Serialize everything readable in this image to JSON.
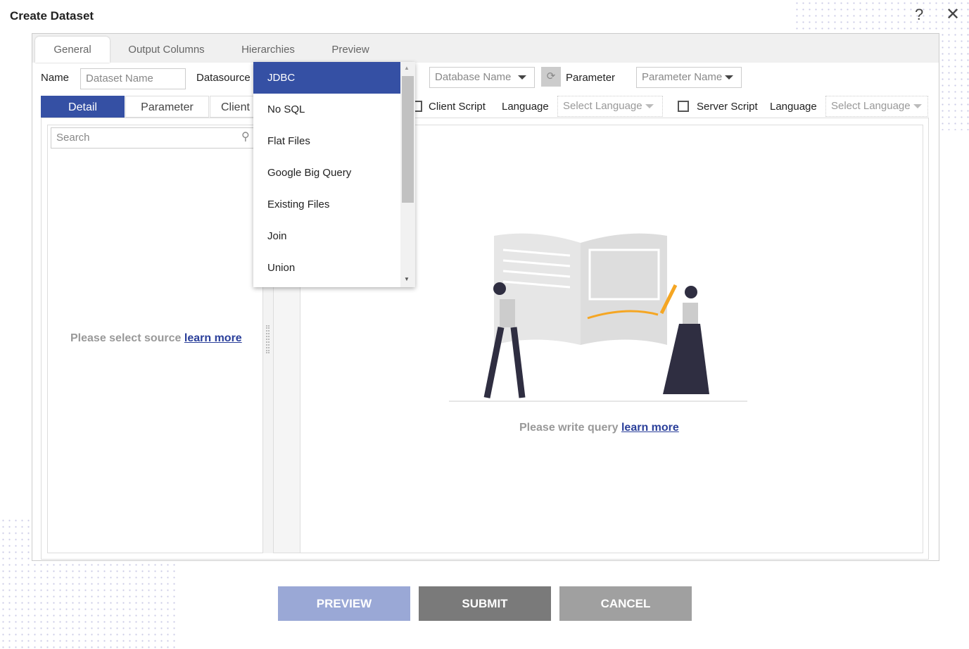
{
  "title": "Create Dataset",
  "tabs": [
    "General",
    "Output Columns",
    "Hierarchies",
    "Preview"
  ],
  "name_label": "Name",
  "name_placeholder": "Dataset Name",
  "datasource_label": "Datasource",
  "datasource_options": [
    "JDBC",
    "No SQL",
    "Flat Files",
    "Google Big Query",
    "Existing Files",
    "Join",
    "Union"
  ],
  "database_placeholder": "Database Name",
  "parameter_label": "Parameter",
  "parameter_placeholder": "Parameter Name",
  "subtabs": [
    "Detail",
    "Parameter",
    "Client"
  ],
  "client_script": "Client Script",
  "server_script": "Server Script",
  "language_label": "Language",
  "select_language": "Select Language",
  "search_placeholder": "Search",
  "left_msg": "Please select source",
  "right_msg": "Please write query",
  "learn_more": "learn more",
  "buttons": {
    "preview": "PREVIEW",
    "submit": "SUBMIT",
    "cancel": "CANCEL"
  },
  "colors": {
    "accent": "#3550a4",
    "preview": "#9aa8d6",
    "submit": "#7a7a7a",
    "cancel": "#a0a0a0"
  }
}
